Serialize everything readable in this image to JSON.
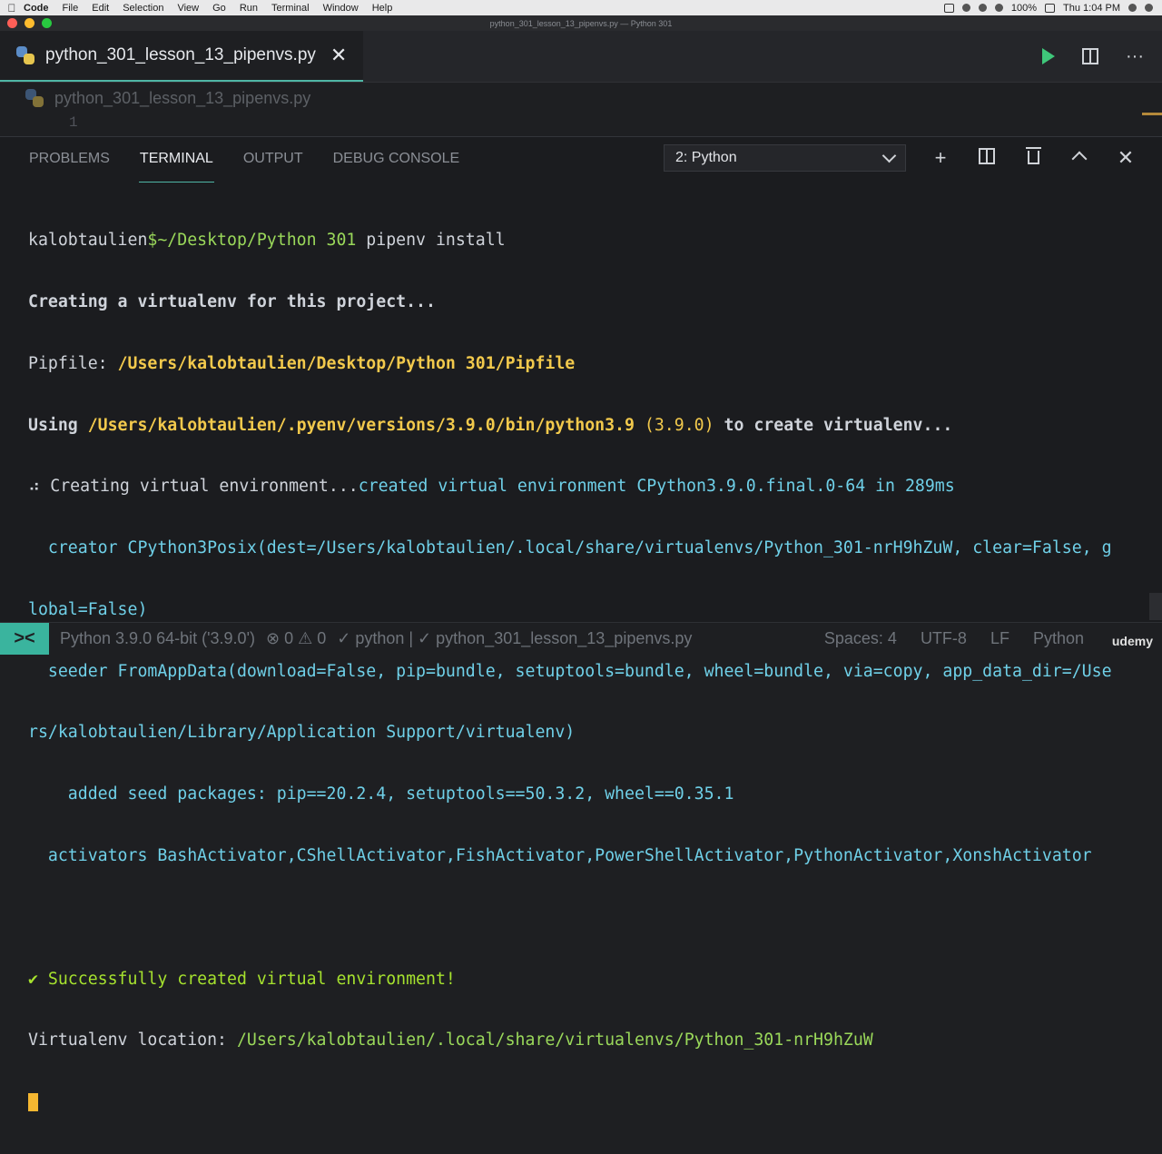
{
  "menubar": {
    "apple": "",
    "app": "Code",
    "items": [
      "File",
      "Edit",
      "Selection",
      "View",
      "Go",
      "Run",
      "Terminal",
      "Window",
      "Help"
    ],
    "battery": "100%",
    "clock": "Thu 1:04 PM"
  },
  "window": {
    "title": "python_301_lesson_13_pipenvs.py — Python 301"
  },
  "editor": {
    "tab_label": "python_301_lesson_13_pipenvs.py",
    "tab_close": "✕",
    "breadcrumb": "python_301_lesson_13_pipenvs.py",
    "line_number": "1",
    "more_actions": "···"
  },
  "panel": {
    "tabs": [
      "PROBLEMS",
      "TERMINAL",
      "OUTPUT",
      "DEBUG CONSOLE"
    ],
    "active_tab": "TERMINAL",
    "terminal_select": "2: Python",
    "add": "+",
    "close": "✕"
  },
  "terminal": {
    "prompt_user": "kalobtaulien",
    "prompt_path": "$~/Desktop/Python 301",
    "command": " pipenv install",
    "l2": "Creating a virtualenv for this project...",
    "l3_label": "Pipfile: ",
    "l3_path": "/Users/kalobtaulien/Desktop/Python 301/Pipfile",
    "l4_a": "Using ",
    "l4_path": "/Users/kalobtaulien/.pyenv/versions/3.9.0/bin/python3.9",
    "l4_ver": " (3.9.0)",
    "l4_b": " to create virtualenv...",
    "l5_a": "⠴ Creating virtual environment...",
    "l5_b": "created virtual environment CPython3.9.0.final.0-64 in 289ms",
    "l6": "  creator CPython3Posix(dest=/Users/kalobtaulien/.local/share/virtualenvs/Python_301-nrH9hZuW, clear=False, g",
    "l7": "lobal=False)",
    "l8": "  seeder FromAppData(download=False, pip=bundle, setuptools=bundle, wheel=bundle, via=copy, app_data_dir=/Use",
    "l9": "rs/kalobtaulien/Library/Application Support/virtualenv)",
    "l10": "    added seed packages: pip==20.2.4, setuptools==50.3.2, wheel==0.35.1",
    "l11": "  activators BashActivator,CShellActivator,FishActivator,PowerShellActivator,PythonActivator,XonshActivator",
    "l13": "✔ Successfully created virtual environment!",
    "l14_label": "Virtualenv location: ",
    "l14_path": "/Users/kalobtaulien/.local/share/virtualenvs/Python_301-nrH9hZuW"
  },
  "statusbar": {
    "remote": "><",
    "interpreter": "Python 3.9.0 64-bit ('3.9.0')",
    "problems": "⊗ 0 ⚠ 0",
    "task": "✓ python | ✓ python_301_lesson_13_pipenvs.py",
    "spaces": "Spaces: 4",
    "encoding": "UTF-8",
    "eol": "LF",
    "language": "Python"
  },
  "watermark": "udemy",
  "colors": {
    "accent": "#3ab49e",
    "run_green": "#3fc77a",
    "path_yellow": "#f2c94c",
    "info_cyan": "#6fd0e8",
    "success_green": "#a6e22e",
    "cursor": "#f5b731"
  }
}
